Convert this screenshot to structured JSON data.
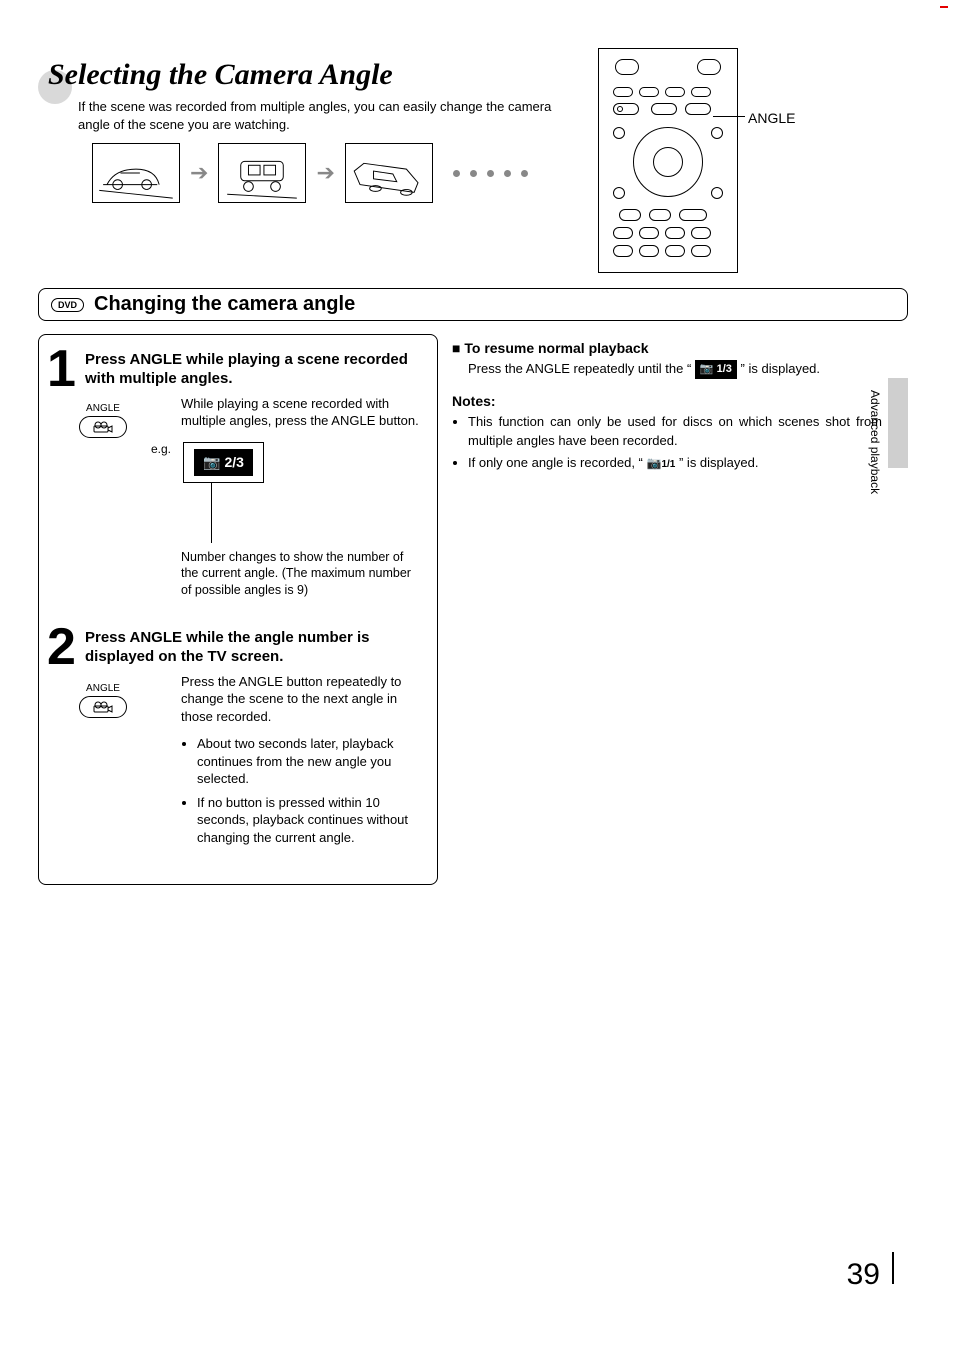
{
  "header": {
    "title": "Selecting the Camera Angle",
    "intro": "If the scene was recorded from multiple angles, you can easily change the camera angle of the scene you are watching.",
    "remote_callout": "ANGLE"
  },
  "subheading": {
    "disc_label": "DVD",
    "title": "Changing the camera angle"
  },
  "step1": {
    "number": "1",
    "title": "Press ANGLE while playing a scene recorded with multiple angles.",
    "button_label": "ANGLE",
    "body": "While playing a scene recorded with multiple angles, press the ANGLE button.",
    "eg_label": "e.g.",
    "osd_value": "2/3",
    "caption": "Number changes to show the number of the current angle. (The maximum number of possible angles is 9)"
  },
  "step2": {
    "number": "2",
    "title": "Press ANGLE while the angle number is displayed on the TV screen.",
    "button_label": "ANGLE",
    "body": "Press the ANGLE button repeatedly to change the scene to the next angle in those recorded.",
    "bullets": [
      "About two seconds later, playback continues from the new angle you selected.",
      "If no button is pressed within 10 seconds, playback continues without changing the current angle."
    ]
  },
  "right": {
    "resume_title": "To resume normal playback",
    "resume_pre": "Press the ANGLE repeatedly until the “ ",
    "resume_chip": "1/3",
    "resume_post": " ” is displayed.",
    "notes_title": "Notes:",
    "notes": [
      "This function can only be used for discs on which scenes shot from multiple angles have been recorded."
    ],
    "note2_pre": "If only one angle is recorded, “ ",
    "note2_chip": "1/1",
    "note2_post": " ” is displayed."
  },
  "side_tab": "Advanced playback",
  "page_number": "39"
}
